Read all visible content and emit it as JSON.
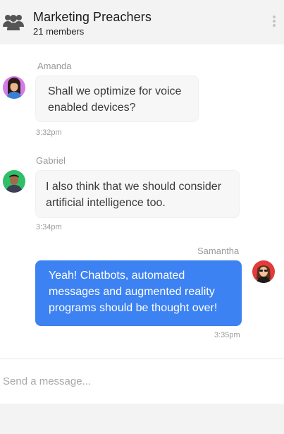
{
  "header": {
    "title": "Marketing Preachers",
    "members": "21 members",
    "icon": "group-icon",
    "menu_icon": "more-vertical-icon"
  },
  "messages": [
    {
      "author": "Amanda",
      "text": "Shall we optimize for voice enabled devices?",
      "time": "3:32pm",
      "direction": "incoming"
    },
    {
      "author": "Gabriel",
      "text": "I also think that we should consider artificial intelligence too.",
      "time": "3:34pm",
      "direction": "incoming"
    },
    {
      "author": "Samantha",
      "text": "Yeah! Chatbots, automated messages and augmented reality programs should be thought over!",
      "time": "3:35pm",
      "direction": "outgoing"
    }
  ],
  "composer": {
    "placeholder": "Send a message..."
  },
  "colors": {
    "outgoing_bubble": "#3d82f2",
    "incoming_bubble": "#f7f7f7",
    "header_bg": "#f3f3f3"
  }
}
